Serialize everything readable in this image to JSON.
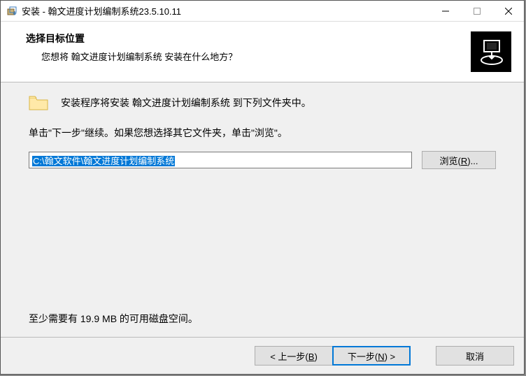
{
  "window": {
    "title": "安装 - 翰文进度计划编制系统23.5.10.11"
  },
  "header": {
    "title": "选择目标位置",
    "subtitle": "您想将 翰文进度计划编制系统 安装在什么地方？"
  },
  "body": {
    "intro": "安装程序将安装 翰文进度计划编制系统 到下列文件夹中。",
    "hint": "单击\"下一步\"继续。如果您想选择其它文件夹，单击\"浏览\"。",
    "path": "C:\\翰文软件\\翰文进度计划编制系统",
    "browse_label_prefix": "浏览(",
    "browse_label_underline": "R",
    "browse_label_suffix": ")...",
    "disk_space": "至少需要有 19.9 MB 的可用磁盘空间。"
  },
  "footer": {
    "back_prefix": "< 上一步(",
    "back_u": "B",
    "back_suffix": ")",
    "next_prefix": "下一步(",
    "next_u": "N",
    "next_suffix": ") >",
    "cancel": "取消"
  }
}
